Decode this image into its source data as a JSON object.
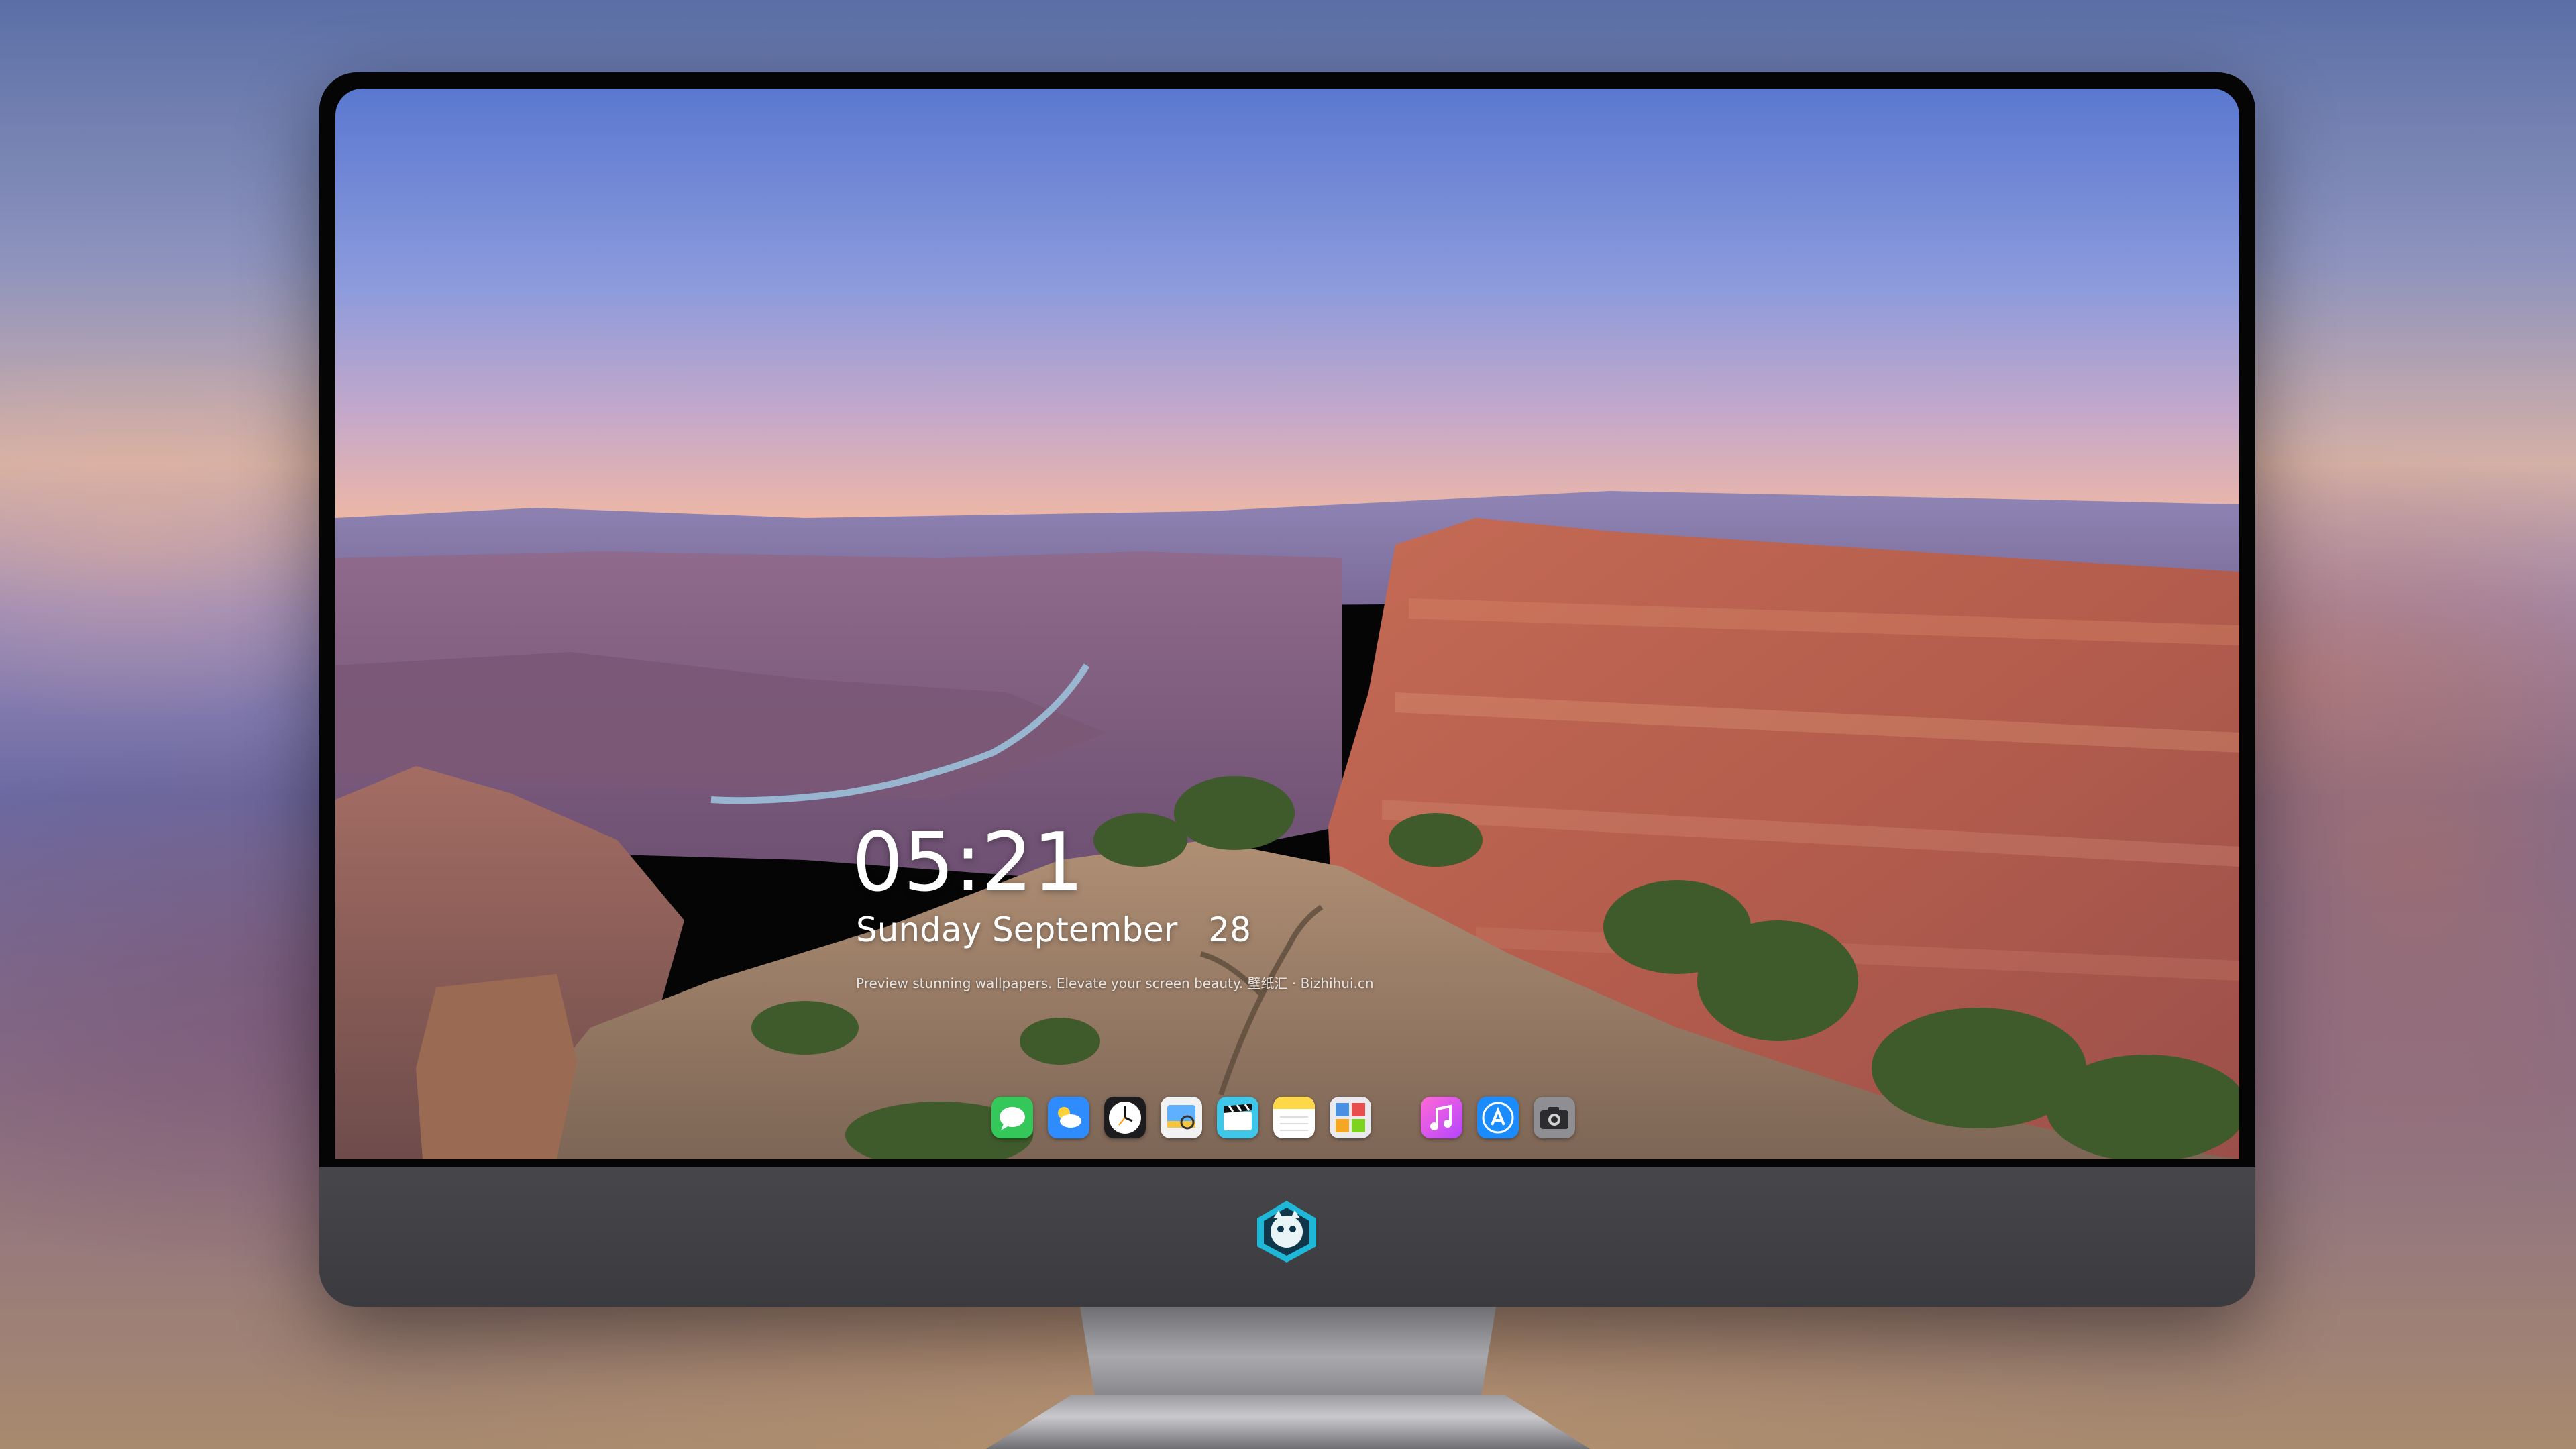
{
  "lock_screen": {
    "time": "05:21",
    "weekday": "Sunday",
    "month": "September",
    "day": "28",
    "tagline": "Preview stunning wallpapers. Elevate your screen beauty. 壁纸汇 · Bizhihui.cn"
  },
  "dock": {
    "apps": [
      {
        "icon": "messages-icon",
        "color": "#34c759"
      },
      {
        "icon": "weather-icon",
        "color": "#2f8cff"
      },
      {
        "icon": "clock-icon",
        "color": "#ffffff"
      },
      {
        "icon": "preview-icon",
        "color": "#f5c542"
      },
      {
        "icon": "clips-icon",
        "color": "#3ec7e8"
      },
      {
        "icon": "notes-icon",
        "color": "#ffd84a"
      },
      {
        "icon": "photo-booth-icon",
        "color": "#e9e9ee"
      },
      {
        "icon": "music-icon",
        "color": "#ff4fd2"
      },
      {
        "icon": "app-store-icon",
        "color": "#1a8cff"
      },
      {
        "icon": "camera-icon",
        "color": "#8e8e93"
      }
    ]
  },
  "colors": {
    "sky_top": "#5a7ad0",
    "sky_horizon": "#f0b7a2",
    "canyon_red": "#b75e4a",
    "bezel": "#050505",
    "chin": "#3e3e42"
  }
}
